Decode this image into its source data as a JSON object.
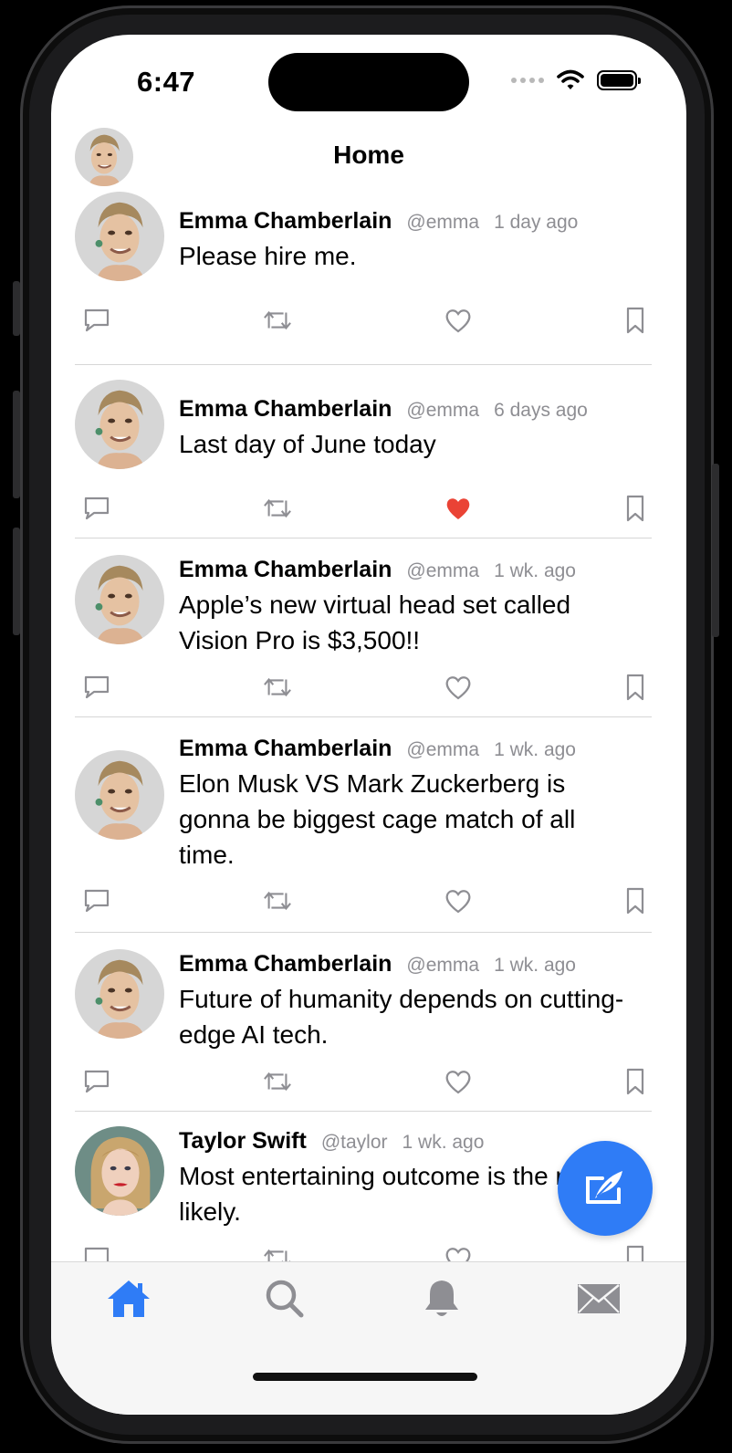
{
  "status_bar": {
    "time": "6:47"
  },
  "header": {
    "title": "Home"
  },
  "colors": {
    "accent": "#2f7cf6",
    "liked": "#ea4335",
    "secondary_text": "#8e8e93",
    "icon_gray": "#8e8e93"
  },
  "tweets": [
    {
      "author": "Emma Chamberlain",
      "handle": "@emma",
      "time": "1 day ago",
      "text": "Please hire me.",
      "liked": false,
      "avatar": "emma"
    },
    {
      "author": "Emma Chamberlain",
      "handle": "@emma",
      "time": "6 days ago",
      "text": "Last day of June today",
      "liked": true,
      "avatar": "emma"
    },
    {
      "author": "Emma Chamberlain",
      "handle": "@emma",
      "time": "1 wk. ago",
      "text": "Apple’s new virtual head set called Vision Pro is $3,500!!",
      "liked": false,
      "avatar": "emma"
    },
    {
      "author": "Emma Chamberlain",
      "handle": "@emma",
      "time": "1 wk. ago",
      "text": "Elon Musk VS Mark Zuckerberg is gonna be biggest cage match of all time.",
      "liked": false,
      "avatar": "emma"
    },
    {
      "author": "Emma Chamberlain",
      "handle": "@emma",
      "time": "1 wk. ago",
      "text": "Future of humanity depends on cutting-edge AI tech.",
      "liked": false,
      "avatar": "emma"
    },
    {
      "author": "Taylor Swift",
      "handle": "@taylor",
      "time": "1 wk. ago",
      "text": "Most entertaining outcome is the most likely.",
      "liked": false,
      "avatar": "taylor"
    }
  ],
  "tweet_actions": [
    "comment-icon",
    "retweet-icon",
    "heart-icon",
    "bookmark-icon"
  ],
  "compose_button": {
    "icon": "compose-feather-icon"
  },
  "tab_bar": {
    "tabs": [
      {
        "icon": "home-icon",
        "selected": true
      },
      {
        "icon": "search-icon",
        "selected": false
      },
      {
        "icon": "bell-icon",
        "selected": false
      },
      {
        "icon": "envelope-icon",
        "selected": false
      }
    ]
  }
}
